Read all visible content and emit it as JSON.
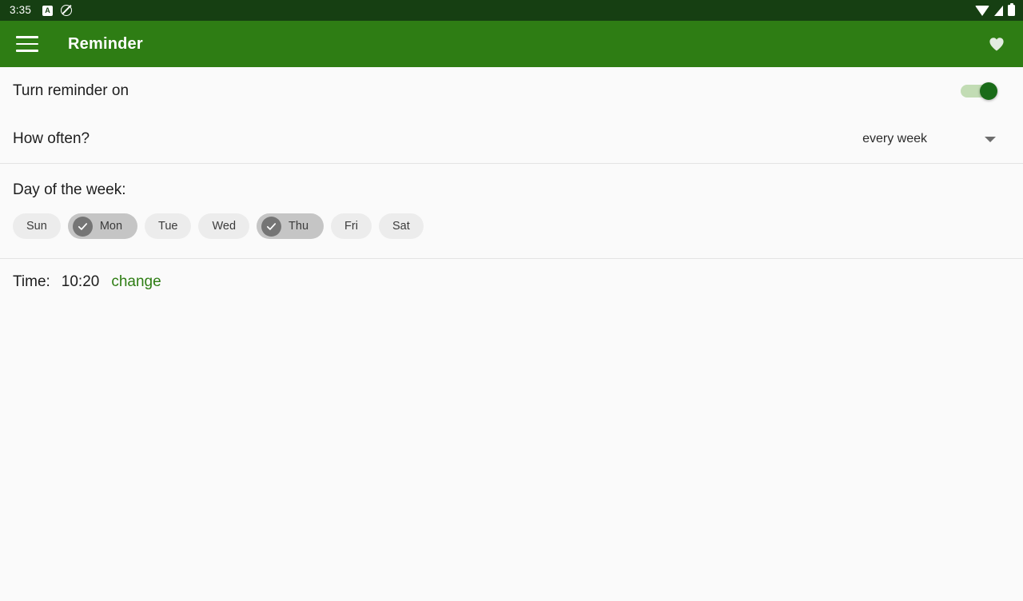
{
  "status_bar": {
    "clock": "3:35",
    "left_icons": [
      "a-letter-icon",
      "do-not-disturb-icon"
    ],
    "right_icons": [
      "wifi-icon",
      "cellular-signal-icon",
      "battery-icon"
    ],
    "a_icon_letter": "A",
    "background_color": "#163f12"
  },
  "app_bar": {
    "menu_icon": "hamburger-menu-icon",
    "title": "Reminder",
    "action_icon": "heart-icon",
    "background_color": "#2e7d14"
  },
  "settings": {
    "reminder_toggle": {
      "label": "Turn reminder on",
      "state": "on",
      "thumb_color": "#196b18",
      "track_color": "#c2dcb4"
    },
    "frequency": {
      "label": "How often?",
      "selected_value": "every week",
      "caret_icon": "chevron-down-icon"
    },
    "day_of_week": {
      "title": "Day of the week:",
      "chips": [
        {
          "label": "Sun",
          "selected": false
        },
        {
          "label": "Mon",
          "selected": true
        },
        {
          "label": "Tue",
          "selected": false
        },
        {
          "label": "Wed",
          "selected": false
        },
        {
          "label": "Thu",
          "selected": true
        },
        {
          "label": "Fri",
          "selected": false
        },
        {
          "label": "Sat",
          "selected": false
        }
      ]
    },
    "time": {
      "label": "Time:",
      "value": "10:20",
      "change_link": "change",
      "link_color": "#2e7d14"
    }
  }
}
